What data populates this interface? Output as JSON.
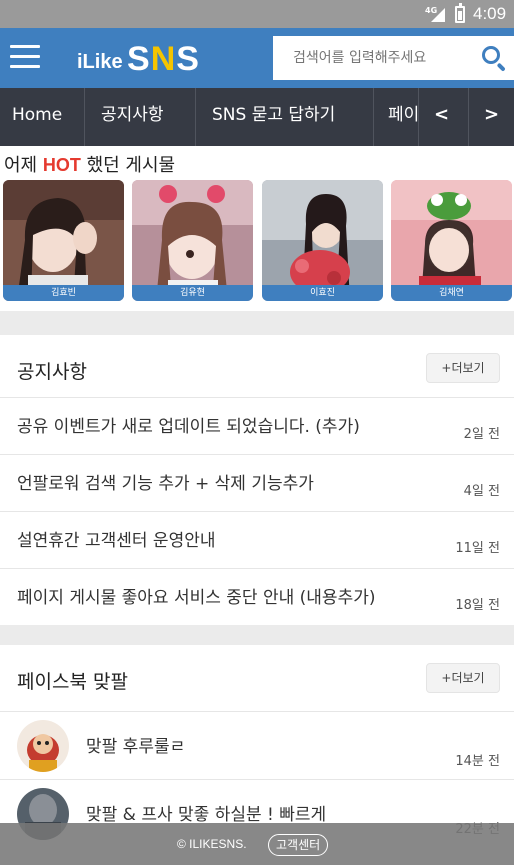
{
  "status_bar": {
    "network": "4G",
    "time": "4:09"
  },
  "header": {
    "logo_prefix": "iLike",
    "logo_sn": "S",
    "logo_n": "N",
    "logo_s": "S",
    "search_placeholder": "검색어를 입력해주세요"
  },
  "nav": {
    "tabs": [
      "Home",
      "공지사항",
      "SNS 묻고 답하기",
      "페이스북"
    ],
    "prev": "<",
    "next": ">"
  },
  "hot": {
    "title_before": "어제 ",
    "title_hot": "HOT",
    "title_after": " 했던 게시물",
    "items": [
      {
        "name": "김효빈"
      },
      {
        "name": "김유현"
      },
      {
        "name": "이효진"
      },
      {
        "name": "김채연"
      }
    ]
  },
  "notice": {
    "title": "공지사항",
    "more": "+더보기",
    "items": [
      {
        "text": "공유 이벤트가 새로 업데이트 되었습니다. (추가)",
        "date": "2일 전"
      },
      {
        "text": "언팔로워 검색 기능 추가 + 삭제 기능추가",
        "date": "4일 전"
      },
      {
        "text": "설연휴간 고객센터 운영안내",
        "date": "11일 전"
      },
      {
        "text": "페이지 게시물 좋아요 서비스 중단 안내 (내용추가)",
        "date": "18일 전"
      }
    ]
  },
  "facebook": {
    "title": "페이스북 맞팔",
    "more": "+더보기",
    "items": [
      {
        "text": "맞팔 후루룰ㄹ",
        "date": "14분 전"
      },
      {
        "text": "맞팔 & 프사 맞좋 하실분 ! 빠르게",
        "date": "22분 전"
      }
    ]
  },
  "footer": {
    "copyright": "© ILIKESNS.",
    "cs_button": "고객센터"
  },
  "colors": {
    "brand_blue": "#3f7fbf",
    "nav_dark": "#363a44",
    "hot_red": "#e53a2f",
    "logo_yellow": "#f5c400"
  }
}
